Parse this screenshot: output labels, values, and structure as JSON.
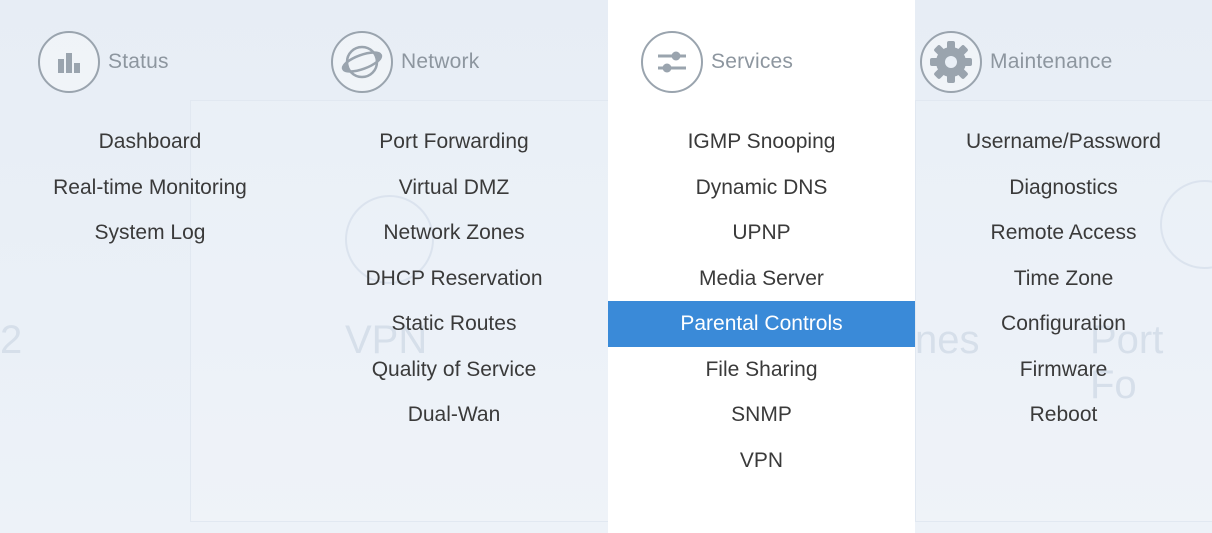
{
  "menu": {
    "columns": [
      {
        "label": "Status",
        "icon": "bar-chart-icon",
        "items": [
          "Dashboard",
          "Real-time Monitoring",
          "System Log"
        ]
      },
      {
        "label": "Network",
        "icon": "globe-icon",
        "items": [
          "Port Forwarding",
          "Virtual DMZ",
          "Network Zones",
          "DHCP Reservation",
          "Static Routes",
          "Quality of Service",
          "Dual-Wan"
        ]
      },
      {
        "label": "Services",
        "icon": "sliders-icon",
        "active": true,
        "items": [
          "IGMP Snooping",
          "Dynamic DNS",
          "UPNP",
          "Media Server",
          "Parental Controls",
          "File Sharing",
          "SNMP",
          "VPN"
        ],
        "selected_item": "Parental Controls"
      },
      {
        "label": "Maintenance",
        "icon": "gear-icon",
        "items": [
          "Username/Password",
          "Diagnostics",
          "Remote Access",
          "Time Zone",
          "Configuration",
          "Firmware",
          "Reboot"
        ]
      }
    ],
    "colors": {
      "selected_bg": "#3a8ad8",
      "selected_text": "#ffffff",
      "item_text": "#3a3a3a",
      "header_text": "#8d969f",
      "menu_bg": "#e9eff6",
      "active_column_bg": "#ffffff"
    }
  },
  "background": {
    "ghost_texts": [
      "VPN",
      "nes",
      "Port Fo",
      "2"
    ]
  }
}
